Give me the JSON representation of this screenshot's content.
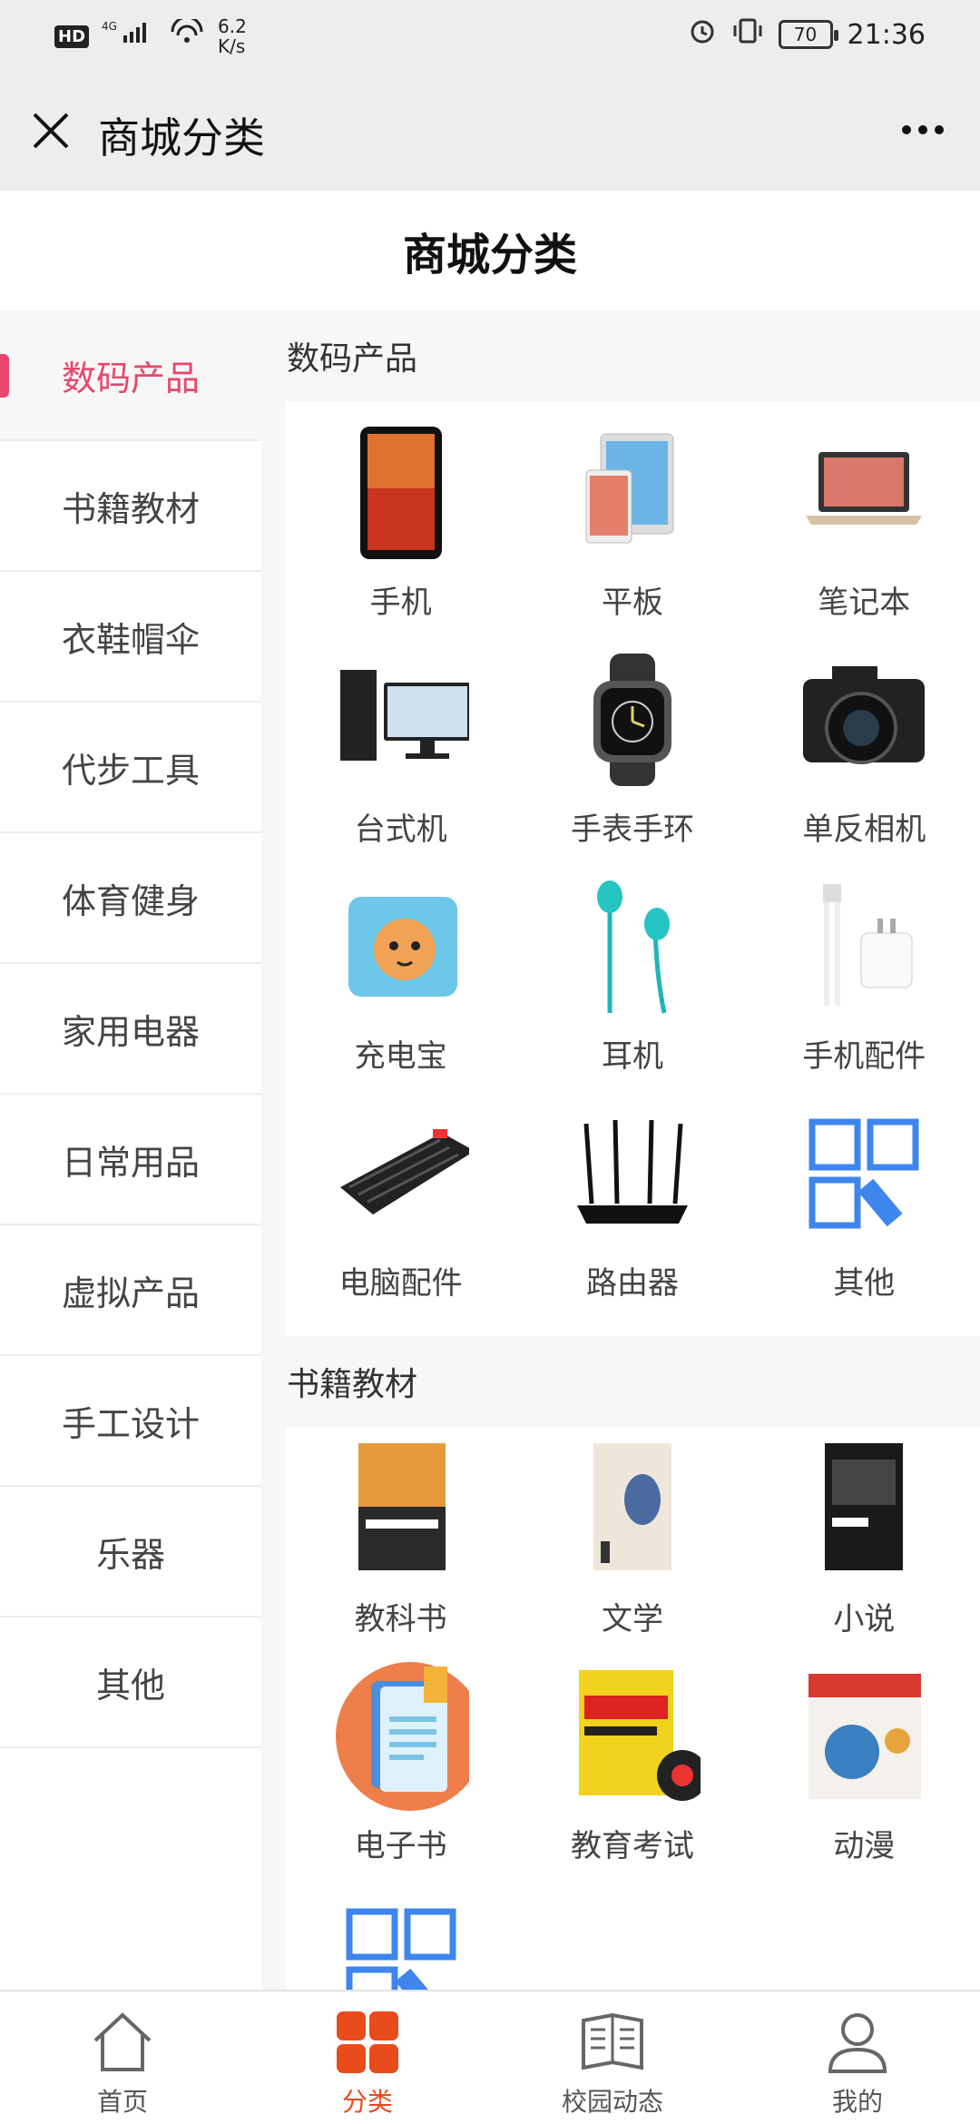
{
  "status": {
    "hd": "HD",
    "network": "4G",
    "speed": "6.2\nK/s",
    "battery": "70",
    "time": "21:36"
  },
  "navbar": {
    "title": "商城分类"
  },
  "page_title": "商城分类",
  "sidebar": {
    "items": [
      {
        "label": "数码产品",
        "active": true
      },
      {
        "label": "书籍教材"
      },
      {
        "label": "衣鞋帽伞"
      },
      {
        "label": "代步工具"
      },
      {
        "label": "体育健身"
      },
      {
        "label": "家用电器"
      },
      {
        "label": "日常用品"
      },
      {
        "label": "虚拟产品"
      },
      {
        "label": "手工设计"
      },
      {
        "label": "乐器"
      },
      {
        "label": "其他"
      }
    ]
  },
  "sections": [
    {
      "title": "数码产品",
      "items": [
        "手机",
        "平板",
        "笔记本",
        "台式机",
        "手表手环",
        "单反相机",
        "充电宝",
        "耳机",
        "手机配件",
        "电脑配件",
        "路由器",
        "其他"
      ]
    },
    {
      "title": "书籍教材",
      "items": [
        "教科书",
        "文学",
        "小说",
        "电子书",
        "教育考试",
        "动漫",
        ""
      ]
    }
  ],
  "tabs": [
    {
      "label": "首页"
    },
    {
      "label": "分类",
      "active": true
    },
    {
      "label": "校园动态"
    },
    {
      "label": "我的"
    }
  ],
  "colors": {
    "accent": "#e8466b",
    "tab_active": "#ea4b1c",
    "other_icon": "#3e86ee"
  }
}
